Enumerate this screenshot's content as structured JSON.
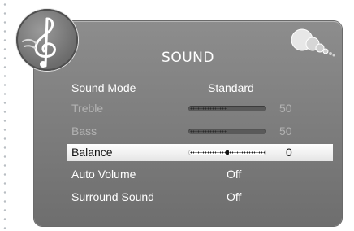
{
  "menu": {
    "title": "SOUND",
    "icon": "music-note-clef-icon",
    "decoration": "bubbles-icon",
    "rows": [
      {
        "label": "Sound Mode",
        "value": "Standard",
        "type": "text",
        "state": "normal"
      },
      {
        "label": "Treble",
        "value": "50",
        "type": "slider",
        "level": 0.5,
        "state": "dim"
      },
      {
        "label": "Bass",
        "value": "50",
        "type": "slider",
        "level": 0.5,
        "state": "dim"
      },
      {
        "label": "Balance",
        "value": "0",
        "type": "slider",
        "level": 0.5,
        "state": "selected"
      },
      {
        "label": "Auto Volume",
        "value": "Off",
        "type": "text",
        "state": "normal"
      },
      {
        "label": "Surround Sound",
        "value": "Off",
        "type": "text",
        "state": "normal"
      }
    ]
  },
  "colors": {
    "panel": "#808080",
    "text": "#ffffff",
    "dim_text": "#b2b2b2",
    "selected_bg": "#f2f2f2",
    "selected_text": "#111111"
  }
}
